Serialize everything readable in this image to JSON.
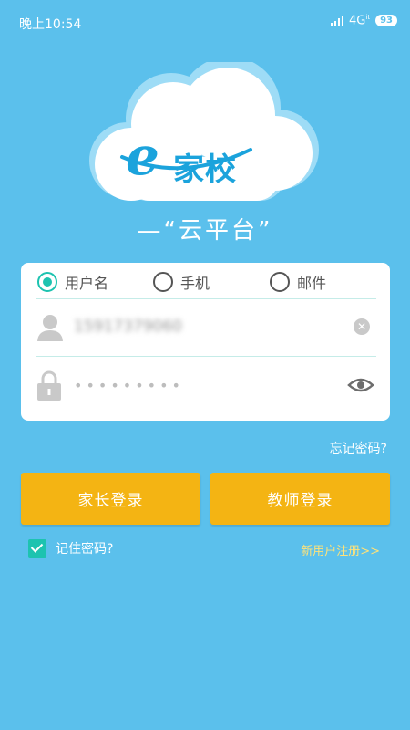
{
  "status_bar": {
    "time": "晚上10:54",
    "network": "4G",
    "network_sub": "it",
    "battery": "93"
  },
  "logo": {
    "e_letter": "e",
    "name": "家校",
    "slogan": "—“云平台”"
  },
  "login_card": {
    "tabs": [
      {
        "label": "用户名",
        "checked": true
      },
      {
        "label": "手机",
        "checked": false
      },
      {
        "label": "邮件",
        "checked": false
      }
    ],
    "username_value": "15917379060",
    "password_mask": "•••••••••"
  },
  "forgot_password": "忘记密码?",
  "buttons": {
    "parent_login": "家长登录",
    "teacher_login": "教师登录"
  },
  "remember_password": {
    "label": "记住密码?",
    "checked": true
  },
  "register_link": "新用户注册>>",
  "colors": {
    "background": "#5bc0ec",
    "accent_teal": "#1dc3b0",
    "button_yellow": "#f4b413",
    "logo_blue": "#1ba3dc",
    "register_yellow": "#fde27a"
  }
}
